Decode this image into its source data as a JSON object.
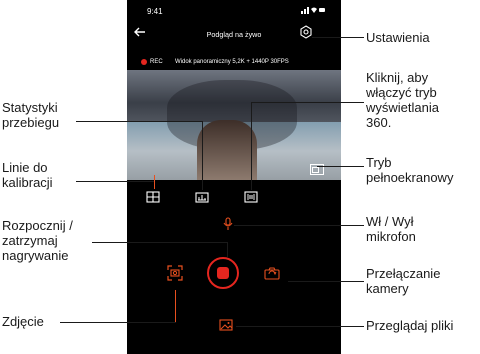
{
  "phone": {
    "status_time": "9:41",
    "header_title": "Podgląd na żywo",
    "rec_label": "REC",
    "stream_info": "Widok panoramiczny 5,2K + 1440P 30FPS",
    "accent_color": "#e5261f"
  },
  "callouts": {
    "settings": "Ustawienia",
    "view360": [
      "Kliknij, aby",
      "włączyć tryb",
      "wyświetlania",
      "360."
    ],
    "stats": [
      "Statystyki",
      "przebiegu"
    ],
    "calib": [
      "Linie do",
      "kalibracji"
    ],
    "fullscreen": [
      "Tryb",
      "pełnoekranowy"
    ],
    "record": [
      "Rozpocznij /",
      "zatrzymaj",
      "nagrywanie"
    ],
    "mic": [
      "Wł / Wył",
      "mikrofon"
    ],
    "switchcam": [
      "Przełączanie",
      "kamery"
    ],
    "photo": "Zdjęcie",
    "files": "Przeglądaj pliki"
  },
  "icons": {
    "back": "arrow-left-icon",
    "settings": "gear-icon",
    "grid": "grid-icon",
    "stats": "odometer-icon",
    "view360": "panorama-icon",
    "fullscreen": "fullscreen-icon",
    "mic": "microphone-icon",
    "photo": "camera-shutter-icon",
    "record": "record-icon",
    "switch": "switch-camera-icon",
    "files": "gallery-icon"
  }
}
